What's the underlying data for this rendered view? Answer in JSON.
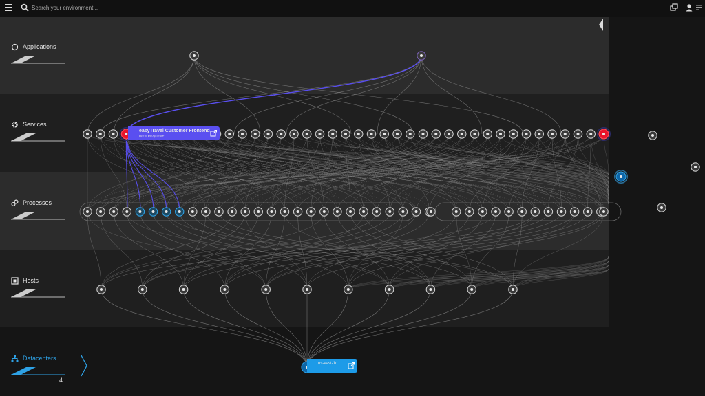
{
  "search": {
    "placeholder": "Search your environment..."
  },
  "layers": [
    {
      "label": "Applications",
      "icon": "circle-icon"
    },
    {
      "label": "Services",
      "icon": "gear-icon"
    },
    {
      "label": "Processes",
      "icon": "processes-icon"
    },
    {
      "label": "Hosts",
      "icon": "host-icon"
    },
    {
      "label": "Datacenters",
      "icon": "datacenter-icon",
      "count": "4"
    }
  ],
  "service_tooltip": {
    "title": "easyTravel Customer Frontend",
    "subtitle": "WEB REQUEST"
  },
  "datacenter_tooltip": {
    "title": "us-east-1d"
  },
  "colors": {
    "accent_blue": "#2ea2e6",
    "service_highlight": "#5a4ff0",
    "error_red": "#e8142a",
    "band_light": "#2c2c2c",
    "band_dark": "#1f1f1f",
    "edge_gray": "#8a8a8a"
  },
  "graph": {
    "apps": 2,
    "services": 41,
    "processes": 40,
    "hosts": 11,
    "datacenters": 1
  }
}
